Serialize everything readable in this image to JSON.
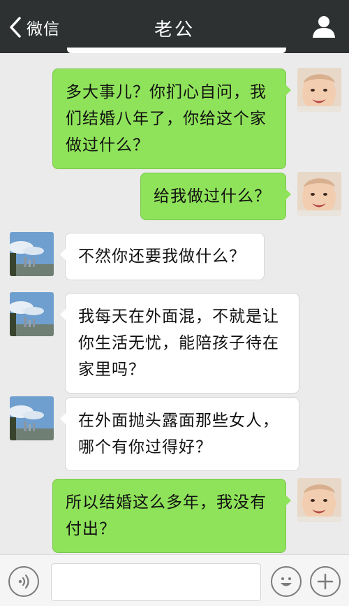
{
  "header": {
    "back_label": "微信",
    "title": "老公"
  },
  "messages": [
    {
      "side": "sent",
      "text": "多大事儿？你扪心自问，我们结婚八年了，你给这个家做过什么？"
    },
    {
      "side": "sent",
      "text": "给我做过什么？"
    },
    {
      "side": "received",
      "text": "不然你还要我做什么？"
    },
    {
      "side": "received",
      "text": "我每天在外面混，不就是让你生活无忧，能陪孩子待在家里吗？"
    },
    {
      "side": "received",
      "text": "在外面抛头露面那些女人，哪个有你过得好？"
    },
    {
      "side": "sent",
      "text": "所以结婚这么多年，我没有付出？"
    }
  ],
  "input_bar": {
    "text_value": "",
    "placeholder": ""
  },
  "colors": {
    "header_bg": "#2e3132",
    "chat_bg": "#ebebeb",
    "sent_bubble": "#8fe35a",
    "received_bubble": "#ffffff"
  },
  "icons": {
    "back": "chevron-left-icon",
    "profile": "person-icon",
    "voice": "voice-icon",
    "emoji": "smiley-icon",
    "more": "plus-icon"
  }
}
